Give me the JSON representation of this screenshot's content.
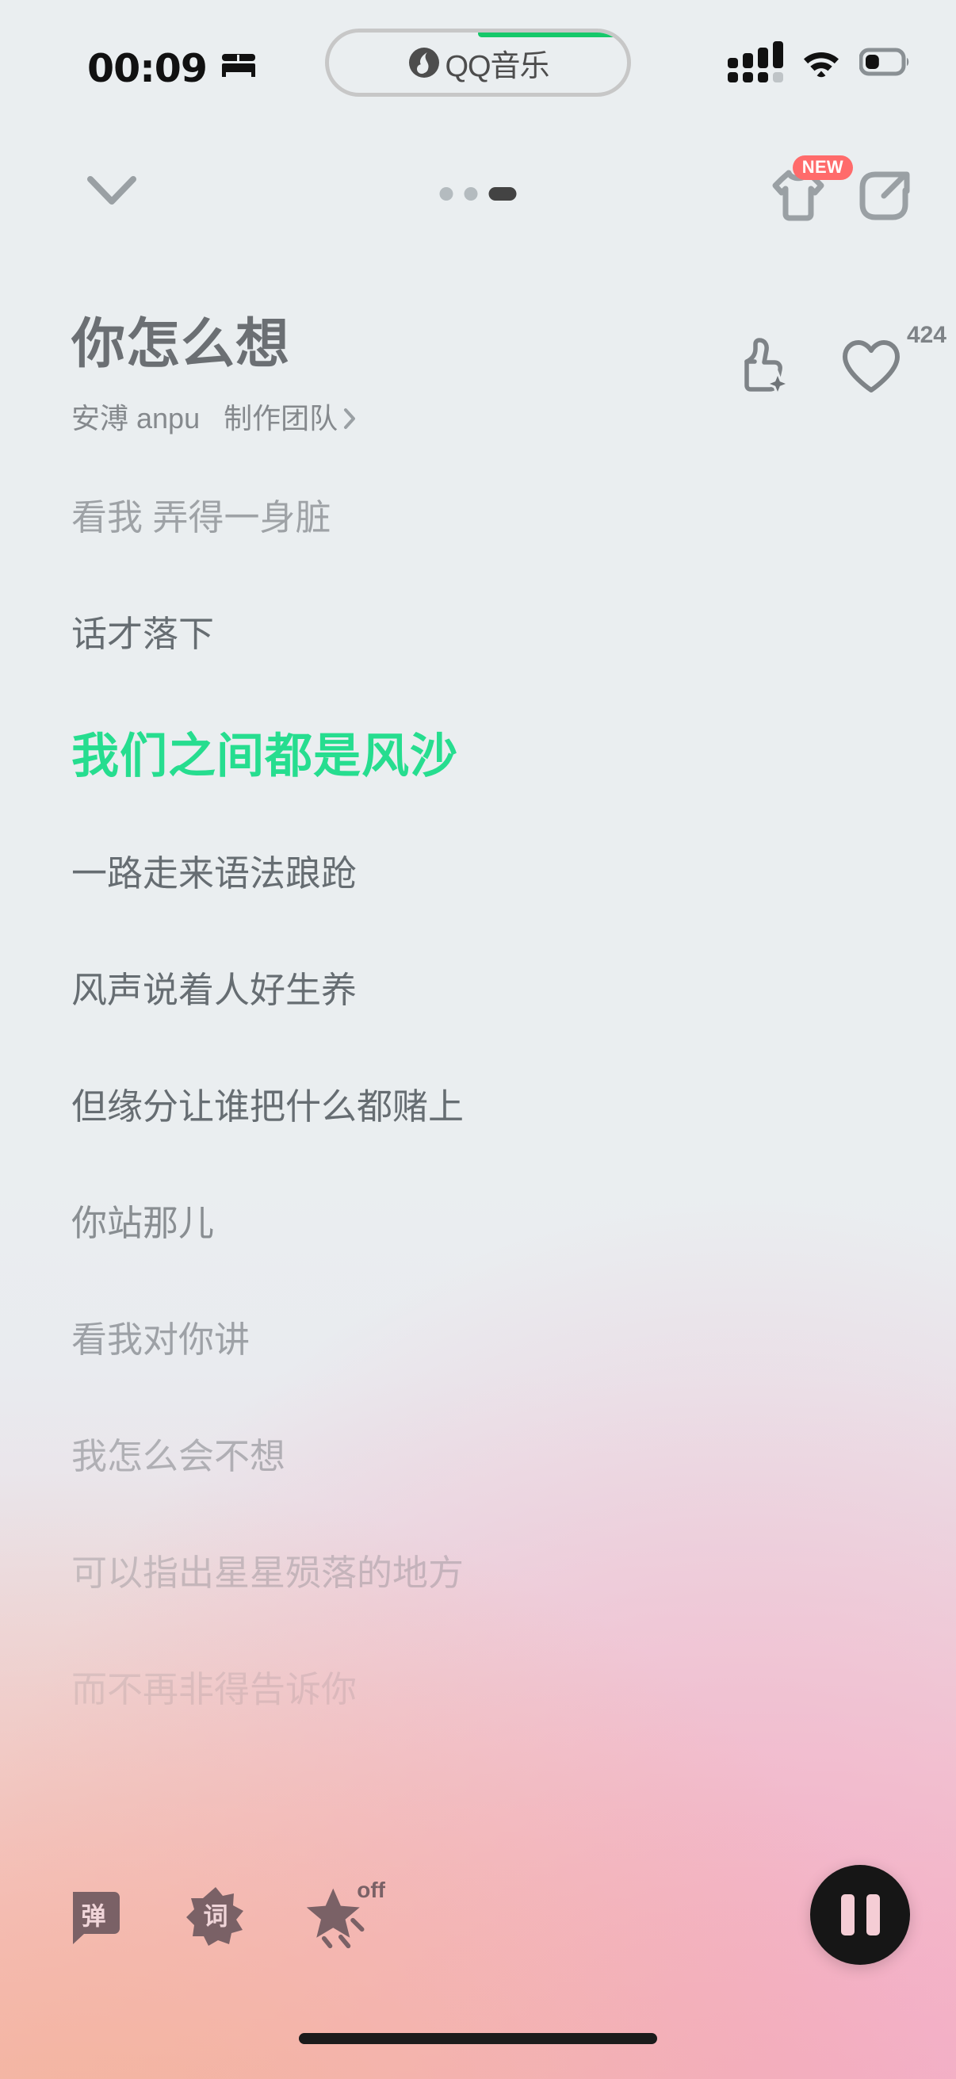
{
  "status_bar": {
    "clock": "00:09",
    "bed_icon": "bed-icon",
    "now_playing_pill": {
      "app_label": "QQ音乐",
      "logo_icon": "qq-music-logo-icon",
      "progress_color": "#16c86a",
      "progress_percent": 50
    },
    "signal_icon": "cellular-signal-icon",
    "wifi_icon": "wifi-icon",
    "battery_icon": "battery-icon",
    "battery_level_percent": 40
  },
  "nav": {
    "collapse_icon": "chevron-down-icon",
    "page_dots": [
      {
        "active": false
      },
      {
        "active": false
      },
      {
        "active": true
      }
    ],
    "theme_icon": "tshirt-icon",
    "theme_badge": "NEW",
    "theme_badge_color": "#ff6b6b",
    "share_icon": "share-icon"
  },
  "song": {
    "title": "你怎么想",
    "artist": "安溥 anpu",
    "credits_label": "制作团队",
    "credits_chevron": "chevron-right-icon",
    "ai_like_icon": "thumbs-up-sparkle-icon",
    "favorite_icon": "heart-outline-icon",
    "favorite_count": "424"
  },
  "lyrics": {
    "active_color": "#26dd8f",
    "lines": [
      {
        "text": "看我 弄得一身脏",
        "state": "past",
        "opacity": 0.55
      },
      {
        "text": "话才落下",
        "state": "past",
        "opacity": 0.95
      },
      {
        "text": "我们之间都是风沙",
        "state": "active",
        "opacity": 1.0
      },
      {
        "text": "一路走来语法踉跄",
        "state": "next",
        "opacity": 0.95
      },
      {
        "text": "风声说着人好生养",
        "state": "next",
        "opacity": 0.95
      },
      {
        "text": "但缘分让谁把什么都赌上",
        "state": "next",
        "opacity": 0.95
      },
      {
        "text": "你站那儿",
        "state": "next",
        "opacity": 0.7
      },
      {
        "text": "看我对你讲",
        "state": "next",
        "opacity": 0.55
      },
      {
        "text": "我怎么会不想",
        "state": "next",
        "opacity": 0.42
      },
      {
        "text": "可以指出星星殒落的地方",
        "state": "next",
        "opacity": 0.28
      },
      {
        "text": "而不再非得告诉你",
        "state": "next",
        "opacity": 0.14
      }
    ]
  },
  "bottom_bar": {
    "tools": [
      {
        "name": "danmaku-button",
        "label": "弹",
        "shape": "speech-bubble"
      },
      {
        "name": "lyrics-button",
        "label": "词",
        "shape": "starburst"
      },
      {
        "name": "effects-button",
        "label": "",
        "shape": "shooting-star",
        "state_label": "off"
      }
    ],
    "play_pause_icon": "pause-icon",
    "play_pause_state": "playing"
  },
  "home_indicator": "home-indicator"
}
